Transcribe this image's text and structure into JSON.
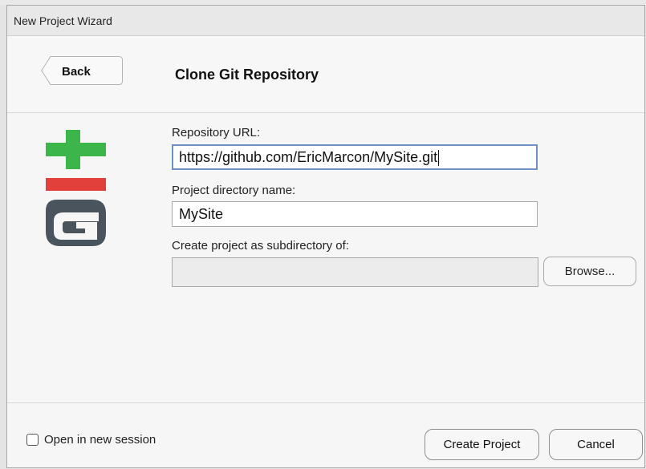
{
  "window": {
    "title": "New Project Wizard"
  },
  "header": {
    "back_label": "Back",
    "page_title": "Clone Git Repository"
  },
  "logo": {
    "name": "git-logo-icon",
    "colors": {
      "plus": "#3cb54a",
      "bar": "#e2403a",
      "letter": "#4a545d"
    }
  },
  "form": {
    "repo_url_label": "Repository URL:",
    "repo_url_value": "https://github.com/EricMarcon/MySite.git",
    "project_dir_label": "Project directory name:",
    "project_dir_value": "MySite",
    "parent_dir_label": "Create project as subdirectory of:",
    "parent_dir_value": "",
    "browse_label": "Browse..."
  },
  "footer": {
    "new_session_label": "Open in new session",
    "new_session_checked": false,
    "create_label": "Create Project",
    "cancel_label": "Cancel"
  },
  "colors": {
    "focus_border": "#6f8fc7"
  }
}
